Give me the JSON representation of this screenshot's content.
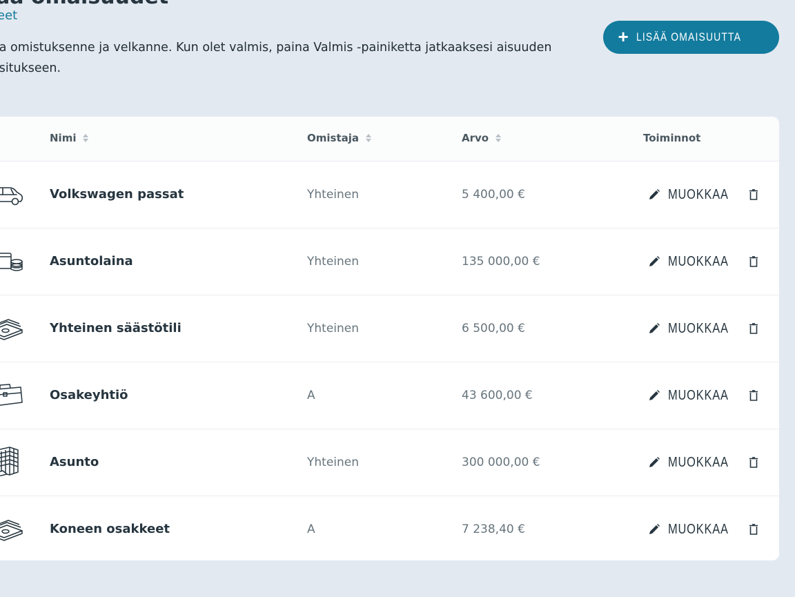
{
  "header": {
    "title": "aa omaisuudet",
    "breadcrumb": "eet",
    "intro": "aa omistuksenne ja velkanne. Kun olet valmis, paina Valmis -painiketta jatkaaksesi aisuuden ositukseen."
  },
  "actions": {
    "add_label": "LISÄÄ OMAISUUTTA"
  },
  "table": {
    "columns": {
      "name": "Nimi",
      "owner": "Omistaja",
      "value": "Arvo",
      "actions": "Toiminnot"
    },
    "edit_label": "MUOKKAA",
    "rows": [
      {
        "icon": "car-icon",
        "name": "Volkswagen passat",
        "owner": "Yhteinen",
        "value": "5 400,00 €"
      },
      {
        "icon": "credit-card-coins-icon",
        "name": "Asuntolaina",
        "owner": "Yhteinen",
        "value": "135 000,00 €"
      },
      {
        "icon": "money-stack-icon",
        "name": "Yhteinen säästötili",
        "owner": "Yhteinen",
        "value": "6 500,00 €"
      },
      {
        "icon": "briefcase-icon",
        "name": "Osakeyhtiö",
        "owner": "A",
        "value": "43 600,00 €"
      },
      {
        "icon": "apartment-building-icon",
        "name": "Asunto",
        "owner": "Yhteinen",
        "value": "300 000,00 €"
      },
      {
        "icon": "money-stack-icon",
        "name": "Koneen osakkeet",
        "owner": "A",
        "value": "7 238,40 €"
      }
    ]
  },
  "colors": {
    "background": "#e3e9f0",
    "primary": "#137b9e",
    "text": "#26353f",
    "muted": "#66747c"
  }
}
